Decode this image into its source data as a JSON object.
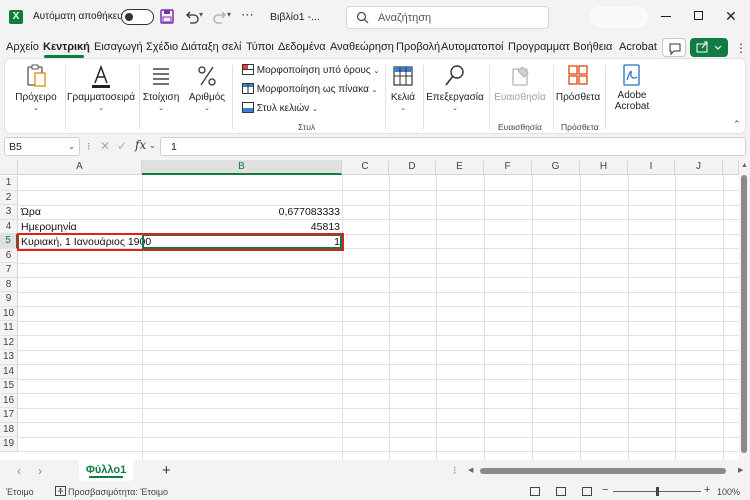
{
  "titlebar": {
    "app_icon": "excel-icon",
    "autosave_label": "Αυτόματη αποθήκευση",
    "autosave_state": "off",
    "doc_title": "Βιβλίο1 -...",
    "search_placeholder": "Αναζήτηση"
  },
  "ribbon_tabs": [
    "Αρχείο",
    "Κεντρική",
    "Εισαγωγή",
    "Σχέδιο",
    "Διάταξη σελί",
    "Τύποι",
    "Δεδομένα",
    "Αναθεώρηση",
    "Προβολή",
    "Αυτοματοποί",
    "Προγραμματ",
    "Βοήθεια",
    "Acrobat"
  ],
  "active_tab": "Κεντρική",
  "ribbon": {
    "clipboard": "Πρόχειρο",
    "font": "Γραμματοσειρά",
    "alignment": "Στοίχιση",
    "number": "Αριθμός",
    "conditional_formatting": "Μορφοποίηση υπό όρους",
    "format_as_table": "Μορφοποίηση ως πίνακα",
    "cell_styles": "Στυλ κελιών",
    "styles_group": "Στυλ",
    "cells": "Κελιά",
    "editing": "Επεξεργασία",
    "sensitivity": "Ευαισθησία",
    "sensitivity_group": "Ευαισθησία",
    "addins": "Πρόσθετα",
    "addins_group": "Πρόσθετα",
    "adobe_acrobat_line1": "Adobe",
    "adobe_acrobat_line2": "Acrobat"
  },
  "formula_bar": {
    "name_box": "B5",
    "formula": "1"
  },
  "columns": [
    "A",
    "B",
    "C",
    "D",
    "E",
    "F",
    "G",
    "H",
    "I",
    "J"
  ],
  "selected_column": "B",
  "rows": [
    "1",
    "2",
    "3",
    "4",
    "5",
    "6",
    "7",
    "8",
    "9",
    "10",
    "11",
    "12",
    "13",
    "14",
    "15",
    "16",
    "17",
    "18",
    "19"
  ],
  "selected_row": "5",
  "cells": {
    "A3": "Ώρα",
    "B3": "0,677083333",
    "A4": "Ημερομηνία",
    "B4": "45813",
    "A5": "Κυριακή, 1 Ιανουάριος 1900",
    "B5": "1"
  },
  "sheet_tabs": {
    "active": "Φύλλο1"
  },
  "statusbar": {
    "ready": "Έτοιμο",
    "accessibility": "Προσβασιμότητα: Έτοιμο",
    "zoom": "100%"
  },
  "colors": {
    "accent": "#107c41",
    "highlight": "#e01f1f"
  }
}
